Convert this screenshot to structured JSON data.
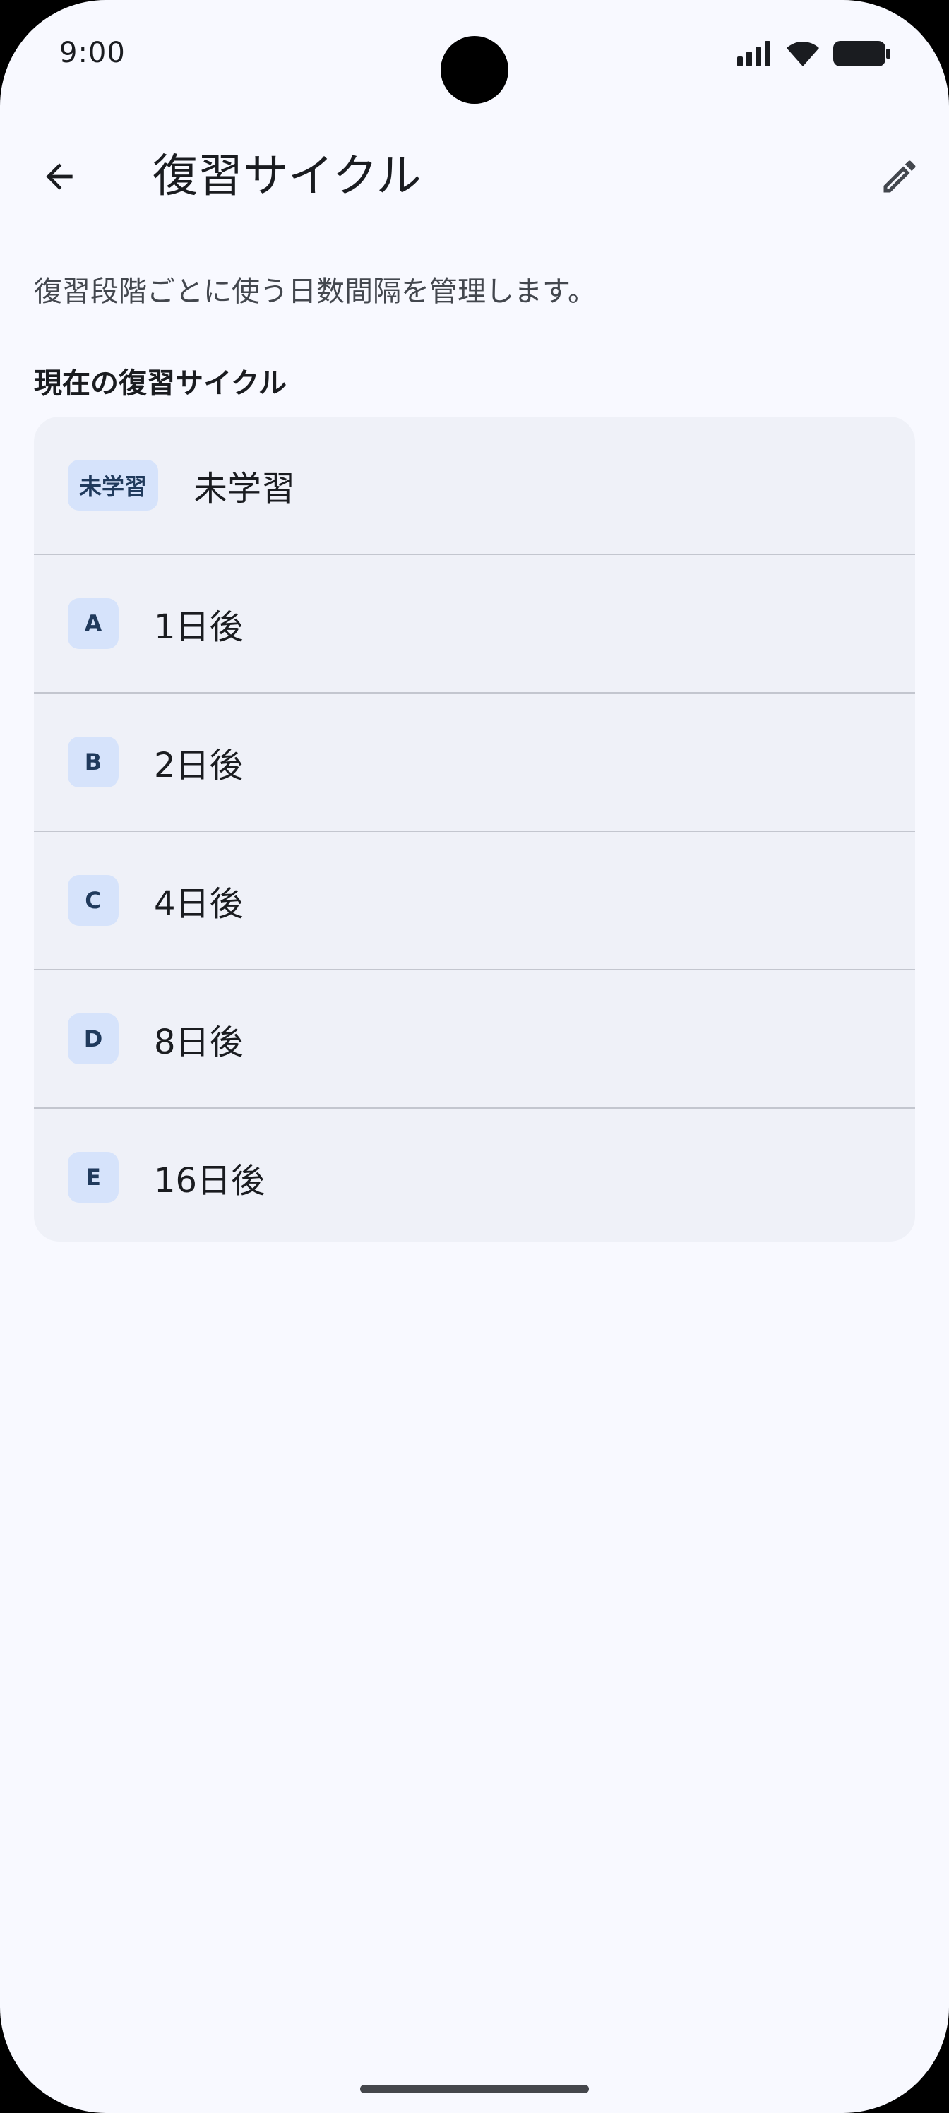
{
  "status_bar": {
    "time": "9:00",
    "icons": [
      "signal-icon",
      "wifi-icon",
      "battery-icon"
    ]
  },
  "app_bar": {
    "title": "復習サイクル",
    "back_icon": "arrow-left-icon",
    "edit_icon": "pencil-icon"
  },
  "description": "復習段階ごとに使う日数間隔を管理します。",
  "section_title": "現在の復習サイクル",
  "cycle_items": [
    {
      "badge": "未学習",
      "label": "未学習"
    },
    {
      "badge": "A",
      "label": "1日後"
    },
    {
      "badge": "B",
      "label": "2日後"
    },
    {
      "badge": "C",
      "label": "4日後"
    },
    {
      "badge": "D",
      "label": "8日後"
    },
    {
      "badge": "E",
      "label": "16日後"
    }
  ],
  "colors": {
    "background": "#f8f9ff",
    "card": "#eff1f8",
    "badge_bg": "#d6e3fb",
    "badge_text": "#203a5c",
    "divider": "#c3c6cf",
    "text_primary": "#1a1c20",
    "text_secondary": "#43474e"
  }
}
